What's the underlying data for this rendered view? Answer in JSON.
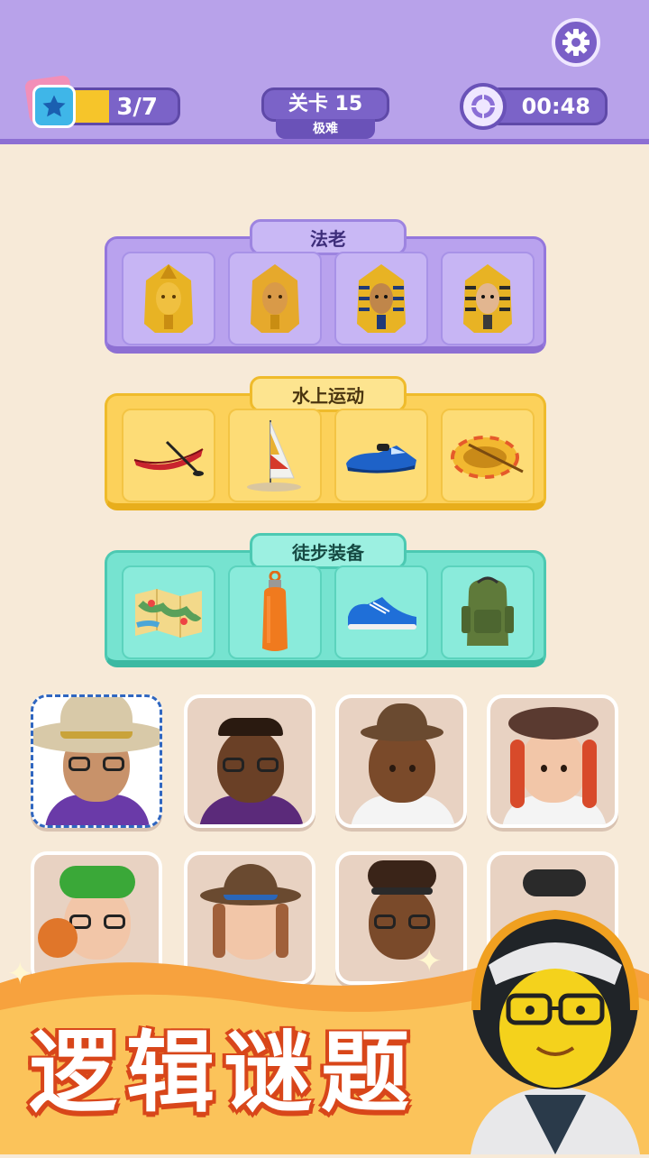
{
  "header": {
    "stars_text": "3/7",
    "stars_progress": 0.43,
    "level_label": "关卡 15",
    "difficulty": "极难",
    "timer": "00:48"
  },
  "icons": {
    "settings": "gear-icon",
    "star": "star-icon",
    "timer": "timer-icon"
  },
  "groups": [
    {
      "label": "法老",
      "color": "#b9a2ee",
      "items": [
        "pharaoh-gold-1",
        "pharaoh-gold-2",
        "pharaoh-striped-1",
        "pharaoh-striped-2"
      ]
    },
    {
      "label": "水上运动",
      "color": "#fcd15a",
      "items": [
        "canoe",
        "windsurf-board",
        "jet-ski",
        "inflatable-raft"
      ]
    },
    {
      "label": "徒步装备",
      "color": "#76e3d0",
      "items": [
        "map",
        "water-bottle",
        "sneaker",
        "backpack"
      ]
    }
  ],
  "characters": [
    {
      "name": "wizard-hat-glasses",
      "selected": true
    },
    {
      "name": "basketball-player"
    },
    {
      "name": "fedora-dreadlocks"
    },
    {
      "name": "beret-redhead"
    },
    {
      "name": "green-hair-basketball"
    },
    {
      "name": "brown-hat-woman"
    },
    {
      "name": "braids-headband"
    },
    {
      "name": "partial-character"
    }
  ],
  "banner": {
    "title": "逻辑谜题"
  },
  "colors": {
    "topbar": "#b8a2ea",
    "background": "#f7ead8",
    "banner_orange": "#f4913a",
    "title_outline": "#d8461a"
  }
}
